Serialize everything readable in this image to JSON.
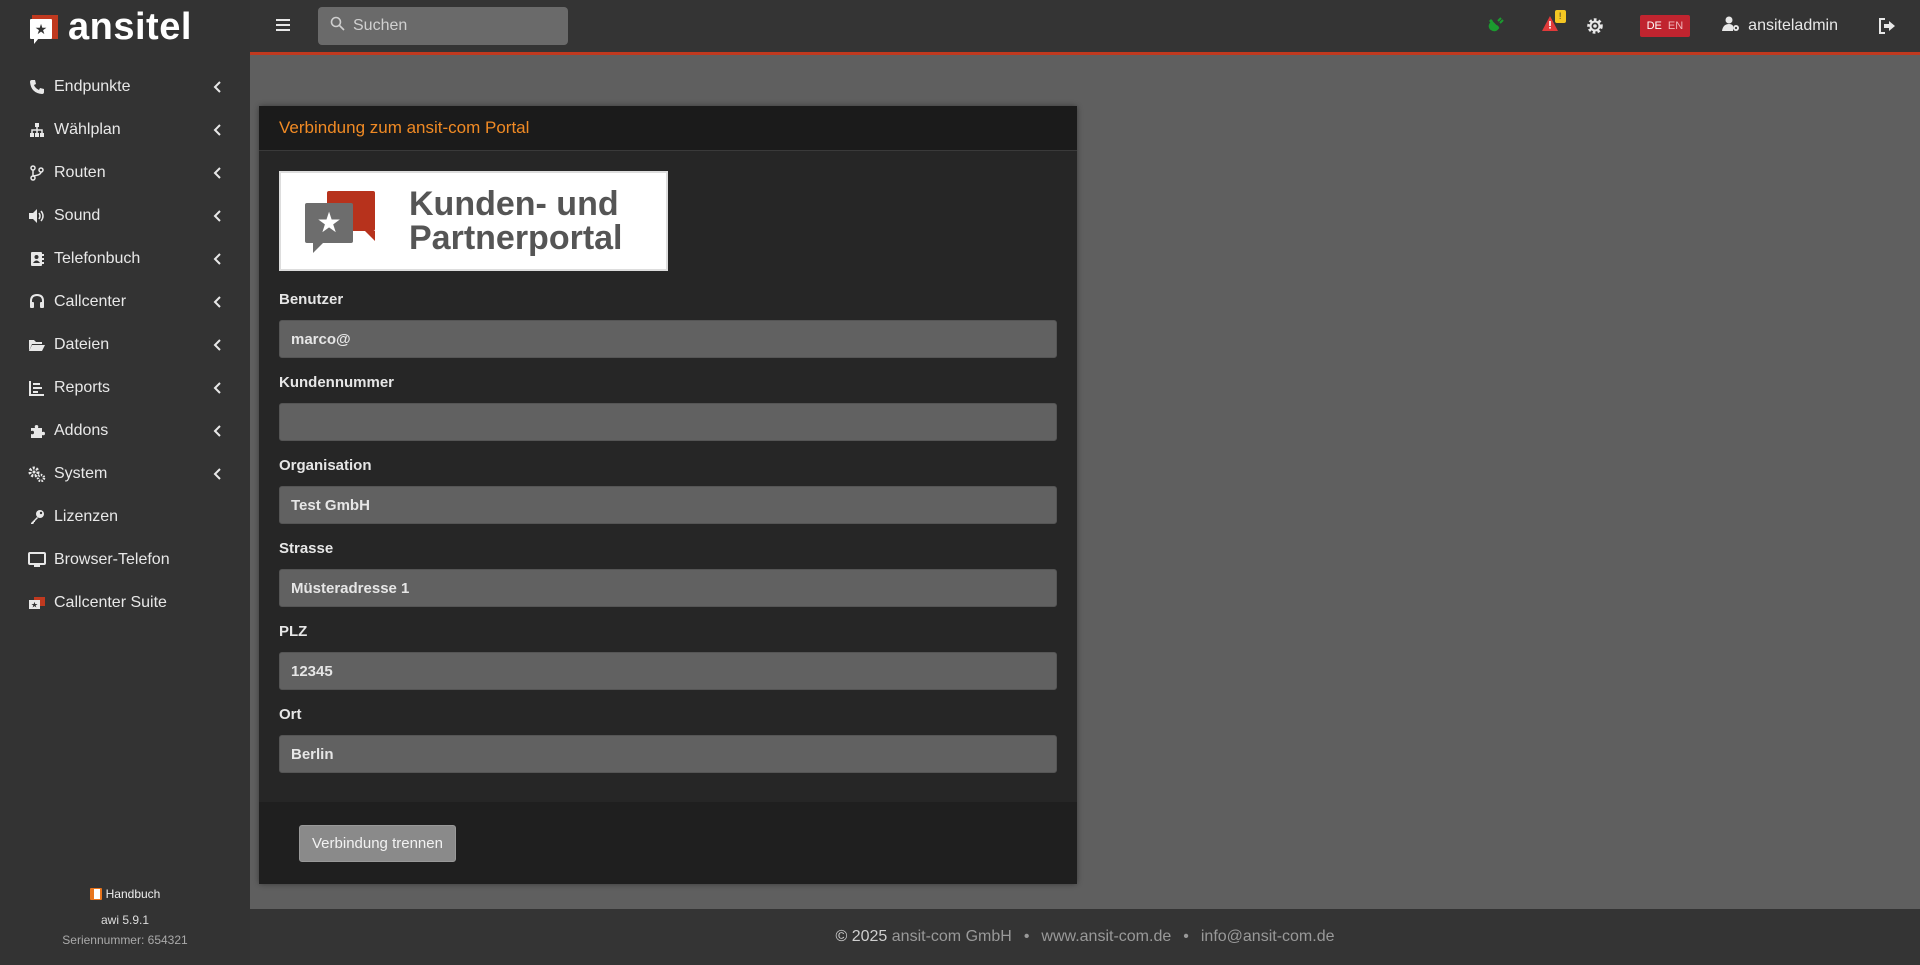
{
  "brand": {
    "name": "ansitel"
  },
  "sidebar": {
    "items": [
      {
        "label": "Endpunkte",
        "icon": "phone-icon",
        "has_children": true
      },
      {
        "label": "Wählplan",
        "icon": "sitemap-icon",
        "has_children": true
      },
      {
        "label": "Routen",
        "icon": "route-icon",
        "has_children": true
      },
      {
        "label": "Sound",
        "icon": "volume-icon",
        "has_children": true
      },
      {
        "label": "Telefonbuch",
        "icon": "address-book-icon",
        "has_children": true
      },
      {
        "label": "Callcenter",
        "icon": "headset-icon",
        "has_children": true
      },
      {
        "label": "Dateien",
        "icon": "folder-open-icon",
        "has_children": true
      },
      {
        "label": "Reports",
        "icon": "chart-icon",
        "has_children": true
      },
      {
        "label": "Addons",
        "icon": "puzzle-icon",
        "has_children": true
      },
      {
        "label": "System",
        "icon": "gears-icon",
        "has_children": true
      },
      {
        "label": "Lizenzen",
        "icon": "key-icon",
        "has_children": false
      },
      {
        "label": "Browser-Telefon",
        "icon": "desktop-icon",
        "has_children": false
      },
      {
        "label": "Callcenter Suite",
        "icon": "callcenter-suite-icon",
        "has_children": false
      }
    ],
    "footer": {
      "handbook": "Handbuch",
      "version": "awi 5.9.1",
      "serial": "Seriennummer: 654321"
    }
  },
  "topbar": {
    "search_placeholder": "Suchen",
    "alert_count": "!",
    "language": {
      "active": "DE",
      "inactive": "EN"
    },
    "username": "ansiteladmin"
  },
  "card": {
    "title": "Verbindung zum ansit-com Portal",
    "banner_text_line1": "Kunden- und",
    "banner_text_line2": "Partnerportal",
    "fields": [
      {
        "label": "Benutzer",
        "value": "marco@"
      },
      {
        "label": "Kundennummer",
        "value": ""
      },
      {
        "label": "Organisation",
        "value": "Test GmbH"
      },
      {
        "label": "Strasse",
        "value": "Müsteradresse 1"
      },
      {
        "label": "PLZ",
        "value": "12345"
      },
      {
        "label": "Ort",
        "value": "Berlin"
      }
    ],
    "disconnect_label": "Verbindung trennen"
  },
  "footer": {
    "copyright": "© 2025",
    "company": "ansit-com GmbH",
    "website": "www.ansit-com.de",
    "email": "info@ansit-com.de",
    "separator": "•"
  },
  "colors": {
    "accent_orange": "#f08a24",
    "brand_red": "#c0391f",
    "sidebar_bg": "#333333",
    "content_bg": "#5f5f5f"
  }
}
